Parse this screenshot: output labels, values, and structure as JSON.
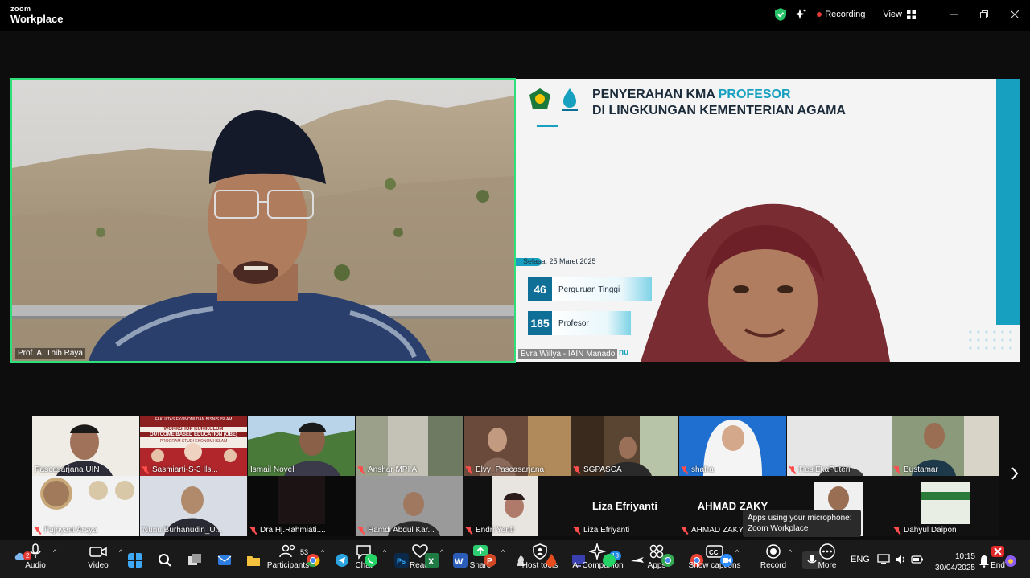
{
  "app": {
    "logo_line1": "zoom",
    "logo_line2": "Workplace",
    "recording_label": "Recording",
    "view_label": "View"
  },
  "speaker": {
    "name": "Prof. A. Thib Raya"
  },
  "presenter": {
    "name": "Evra Willya - IAIN Manado",
    "overlay_fragment": "nu"
  },
  "slide": {
    "title_part1": "PENYERAHAN KMA ",
    "title_accent": "PROFESOR",
    "title_line2": "DI LINGKUNGAN KEMENTERIAN AGAMA",
    "date": "Selasa, 25 Maret 2025",
    "stats": [
      {
        "value": "46",
        "label": "Perguruan Tinggi"
      },
      {
        "value": "185",
        "label": "Profesor"
      }
    ]
  },
  "gallery": {
    "row1": [
      {
        "name": "Pascasarjana UIN",
        "muted": false
      },
      {
        "name": "Sasmiarti-S-3 Ils...",
        "muted": true
      },
      {
        "name": "Ismail Novel",
        "muted": false
      },
      {
        "name": "Anshar MPI A",
        "muted": true
      },
      {
        "name": "Elvy_Pascasarjana",
        "muted": true
      },
      {
        "name": "SGPASCA",
        "muted": true
      },
      {
        "name": "shafra",
        "muted": true
      },
      {
        "name": "HesiEkaPuteri",
        "muted": true
      },
      {
        "name": "Bustamar",
        "muted": true
      }
    ],
    "row2": [
      {
        "name": "Fajriyani Arsya",
        "muted": true
      },
      {
        "name": "Nunu Burhanudin_U...",
        "muted": false
      },
      {
        "name": "Dra.Hj.Rahmiati....",
        "muted": true
      },
      {
        "name": "Hamdi Abdul Kar...",
        "muted": true
      },
      {
        "name": "Endri Yenti",
        "muted": true
      },
      {
        "name": "Liza Efriyanti",
        "muted": true,
        "display_name": "Liza Efriyanti"
      },
      {
        "name": "AHMAD ZAKY",
        "muted": true,
        "display_name": "AHMAD ZAKY"
      },
      {
        "name": "",
        "muted": false
      },
      {
        "name": "Dahyul Daipon",
        "muted": true
      }
    ],
    "tile_text_workshop_1": "FAKULTAS EKONOMI DAN BISNIS ISLAM",
    "tile_text_workshop_2": "WORKSHOP KURIKULUM",
    "tile_text_workshop_3": "OUTCOME BASED EDUCATION (OBE)",
    "tile_text_workshop_4": "PROGRAM STUDI EKONOMI ISLAM"
  },
  "tooltip": {
    "line1": "Apps using your microphone:",
    "line2": "Zoom Workplace"
  },
  "toolbar": {
    "audio": "Audio",
    "video": "Video",
    "participants": "Participants",
    "participants_count": "53",
    "chat": "Chat",
    "react": "React",
    "share": "Share",
    "host_tools": "Host tools",
    "ai_companion": "AI Companion",
    "ai_badge": "18",
    "apps": "Apps",
    "show_captions": "Show captions",
    "record": "Record",
    "more": "More",
    "end": "End",
    "audio_badge": "2"
  },
  "tray": {
    "language": "ENG",
    "time": "10:15",
    "date": "30/04/2025"
  },
  "colors": {
    "active_speaker_border": "#2ee07a",
    "slide_accent": "#17a0c0",
    "recording_dot": "#e53935"
  }
}
